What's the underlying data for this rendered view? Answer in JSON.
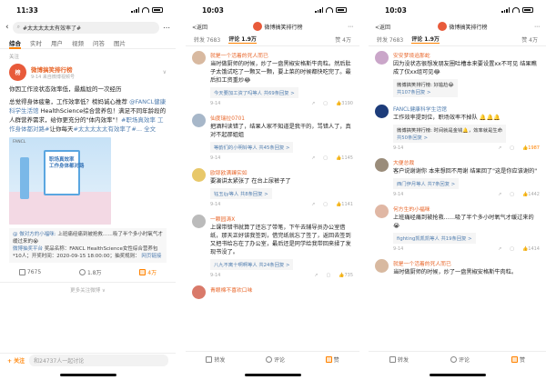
{
  "panel1": {
    "time": "11:33",
    "search_value": "#太太太太太有效率了#",
    "tabs": [
      "综合",
      "实时",
      "用户",
      "视频",
      "问答",
      "图片"
    ],
    "subtabs": "关注",
    "post": {
      "author": "微博搞笑排行榜",
      "meta": "9-14 来自微博视频号",
      "title": "你因工作没状态效率低，最尴尬的一次经历",
      "body1": "总觉得身体疲惫，工作效率低？榜妈诚心推荐",
      "link1": "@FANCL健康科学生活馆",
      "body2": " HealthScience综合营养包！满足不同年龄段的人群营养需求，给你更充分的",
      "body3": "\"体内效率\"！",
      "link2": "#职场真效率 工作身体都对路#",
      "body4": "让你每天",
      "link3": "#太太太太太有效率了#",
      "more": "... 全文",
      "image_logo": "FANCL",
      "image_caption": "职场真效率\n工作身体都对路",
      "repost_name": "@ 做对方的小福咪:",
      "repost_text": "上班痛经痛到被抢救……吸了半个多小时氧气才缓过来的😭",
      "lottery": "微博抽奖平台",
      "lottery_text": "奖品名称：FANCL HealthScience女性综合营养包*10人；开奖时间：2020-09-15 18:00:00；抽奖规则：",
      "lottery_link": "网页链接",
      "repost_count": "7675",
      "comment_count": "1.8万",
      "like_count": "4万",
      "more_results": "更多关注微博 ∨",
      "follow_label": "+ 关注",
      "bottom_text": "和24737人一起讨论"
    }
  },
  "panel2": {
    "time": "10:03",
    "back": "<返回",
    "title": "微博搞笑排行榜",
    "tab_repost": "转发 7683",
    "tab_comment": "评论 1.9万",
    "tab_like": "赞 4万",
    "comments": [
      {
        "name": "就是一个活着的死人而已",
        "text": "当时做厨师的时候，炒了一盘黑椒安格斯牛肉粒。然后肚子太饿试吃了一颗又一颗，要上菜的时候都快吃完了。最后扣工资重炒😂",
        "reply": "今天要加工资了吗等人 共69条回复 >",
        "date": "9-14",
        "n1": "",
        "n2": "",
        "likes": "3190"
      },
      {
        "name": "仙度瑞拉0701",
        "text": "把酒料读错了，结果人家不知道是我干的，骂错人了，真对不起那姐姐",
        "reply": "等韵们的小明铃等人 共45条回复 >",
        "date": "9-14",
        "n1": "",
        "n2": "",
        "likes": "1145"
      },
      {
        "name": "欧耶欧满臻实如",
        "text": "要演讲太紧张了 在台上尿裤子了",
        "reply": "钰玉ijy等人 共8条回复 >",
        "date": "9-14",
        "n1": "",
        "n2": "",
        "likes": "1141"
      },
      {
        "name": "一颗园涛X",
        "text": "上课带错书就算了还忘了带笔，下午去辅导员办公室借纸，那天正好该我签到，借完纸就忘了签了，返回去签到又把书给忘在了办公室，最后还是同学给我带回来揉了发现书没了。",
        "reply": "八九不离十啊啊等人 共24条回复 >",
        "date": "9-14",
        "n1": "",
        "n2": "",
        "likes": "735"
      },
      {
        "name": "青眼棉不喜欢口味",
        "text": "",
        "reply": "",
        "date": "",
        "n1": "",
        "n2": "",
        "likes": ""
      }
    ],
    "bar_repost": "转发",
    "bar_comment": "评论",
    "bar_like": "赞"
  },
  "panel3": {
    "time": "10:03",
    "back": "<返回",
    "title": "微博搞笑排行榜",
    "tab_repost": "转发 7683",
    "tab_comment": "评论 1.9万",
    "tab_like": "赞 4万",
    "comments": [
      {
        "name": "安安梦境追那蛇",
        "text": "因为没状态很想发朋友圈吐槽本来要设置xx不可见 结果瞧成了仅xx组可见😂",
        "reply": "共107条回复 >",
        "date": "9-14",
        "likes": "",
        "sub": "微博搞笑排行榜: 好尴尬😂"
      },
      {
        "name": "FANCL健康科学生活馆",
        "text": "工作效率提到位，职场效率不掉队 🔔🔔🔔",
        "reply": "共50条回复 >",
        "date": "9-14",
        "likes": "1987",
        "sub": "微博搞笑排行榜: 时间就是金钱🔔，效率就是生命"
      },
      {
        "name": "大便总裁",
        "text": "客户说谢谢你 本来想回不用谢 结果回了\"这是你应该谢的\"",
        "reply": "西门伊月等人 共7条回复 >",
        "date": "9-14",
        "likes": "1442",
        "sub": ""
      },
      {
        "name": "何方生的小福咪",
        "text": "上班痛经痛到被抢救……吸了半个多小时氧气才缓过来的😭",
        "reply": "fighting凯凯凯等人 共19条回复 >",
        "date": "9-14",
        "likes": "1414",
        "sub": ""
      },
      {
        "name": "就是一个活着的死人而已",
        "text": "当时做厨师的时候，炒了一盘黑椒安格斯牛肉粒。",
        "reply": "",
        "date": "",
        "likes": "",
        "sub": ""
      }
    ],
    "bar_repost": "转发",
    "bar_comment": "评论",
    "bar_like": "赞"
  },
  "colors": {
    "accent": "#ff8200",
    "link": "#507daf",
    "username": "#e8662a"
  }
}
